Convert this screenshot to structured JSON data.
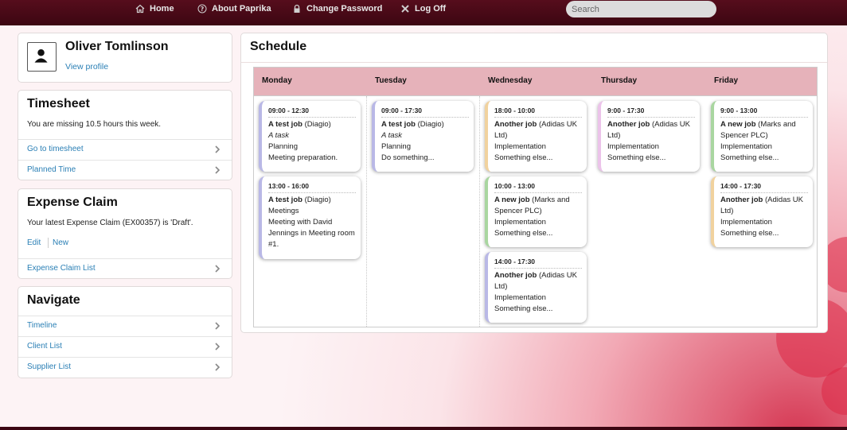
{
  "topnav": {
    "home": "Home",
    "about": "About Paprika",
    "change_password": "Change Password",
    "logoff": "Log Off",
    "search_placeholder": "Search"
  },
  "profile": {
    "name": "Oliver Tomlinson",
    "view_profile": "View profile"
  },
  "timesheet": {
    "title": "Timesheet",
    "message": "You are missing 10.5 hours this week.",
    "links": [
      "Go to timesheet",
      "Planned Time"
    ]
  },
  "expense": {
    "title": "Expense Claim",
    "message": "Your latest Expense Claim (EX00357) is 'Draft'.",
    "edit": "Edit",
    "new": "New",
    "list_link": "Expense Claim List"
  },
  "navigate": {
    "title": "Navigate",
    "links": [
      "Timeline",
      "Client List",
      "Supplier List"
    ]
  },
  "schedule": {
    "title": "Schedule",
    "days": [
      "Monday",
      "Tuesday",
      "Wednesday",
      "Thursday",
      "Friday"
    ],
    "events": {
      "mon1": {
        "time": "09:00 - 12:30",
        "job": "A test job",
        "client": " (Diagio)",
        "task": "A task",
        "activity": "Planning",
        "note": "Meeting preparation."
      },
      "mon2": {
        "time": "13:00 - 16:00",
        "job": "A test job",
        "client": " (Diagio)",
        "activity": "Meetings",
        "note": "Meeting with David Jennings in Meeting room #1."
      },
      "tue1": {
        "time": "09:00 - 17:30",
        "job": "A test job",
        "client": " (Diagio)",
        "task": "A task",
        "activity": "Planning",
        "note": "Do something..."
      },
      "wed1": {
        "time": "18:00 - 10:00",
        "job": "Another job",
        "client": " (Adidas UK Ltd)",
        "activity": "Implementation",
        "note": "Something else..."
      },
      "wed2": {
        "time": "10:00 - 13:00",
        "job": "A new job",
        "client": " (Marks and Spencer PLC)",
        "activity": "Implementation",
        "note": "Something else..."
      },
      "wed3": {
        "time": "14:00 - 17:30",
        "job": "Another job",
        "client": " (Adidas UK Ltd)",
        "activity": "Implementation",
        "note": "Something else..."
      },
      "thu1": {
        "time": "9:00 - 17:30",
        "job": "Another job",
        "client": " (Adidas UK Ltd)",
        "activity": "Implementation",
        "note": "Something else..."
      },
      "fri1": {
        "time": "9:00 - 13:00",
        "job": "A new job",
        "client": " (Marks and Spencer PLC)",
        "activity": "Implementation",
        "note": "Something else..."
      },
      "fri2": {
        "time": "14:00 - 17:30",
        "job": "Another job",
        "client": " (Adidas UK Ltd)",
        "activity": "Implementation",
        "note": "Something else..."
      }
    }
  },
  "colors": {
    "topbar": "#3c0612",
    "link": "#2a7fb5",
    "schedule_header": "#e6b2ba",
    "event_purple": "#b9b8e6",
    "event_orange": "#f1d29e",
    "event_green": "#a9d6a0",
    "event_pink": "#ecc3ea"
  }
}
